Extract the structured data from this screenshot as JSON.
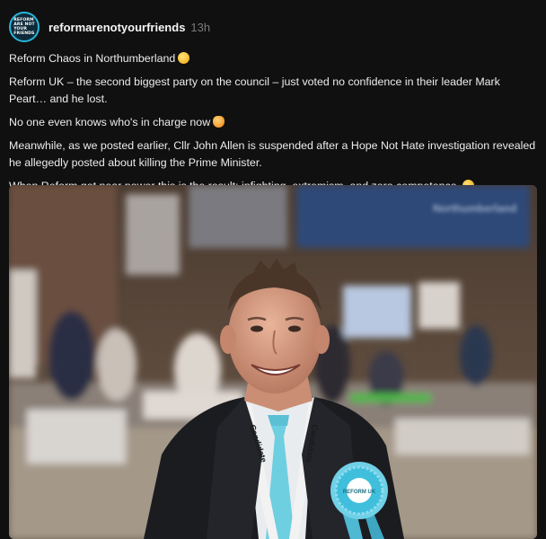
{
  "post": {
    "avatar_text": "REFORM\nARE NOT\nYOUR\nFRIENDS",
    "username": "reformarenotyourfriends",
    "timestamp": "13h",
    "paragraphs": [
      "Reform Chaos in Northumberland",
      "Reform UK – the second biggest party on the council – just voted no confidence in their leader Mark Peart… and he lost.",
      "No one even knows who's in charge now",
      "Meanwhile, as we posted earlier, Cllr John Allen is suspended after a Hope Not Hate investigation revealed he allegedly posted about killing the Prime Minister.",
      "When Reform get near power this is the result: infighting, extremism, and zero competence."
    ],
    "emojis": [
      "grimacing-face-emoji",
      "person-shrugging-emoji",
      "face-with-hand-over-mouth-emoji"
    ]
  },
  "photo": {
    "banner_text": "Northumberland",
    "lanyard_text": "Candidate",
    "rosette_text": "REFORM UK"
  },
  "colors": {
    "background": "#101010",
    "text": "#ececec",
    "muted": "#7a7a7a",
    "avatar_ring": "#27b6d9",
    "reform_blue": "#3fc1dc"
  }
}
